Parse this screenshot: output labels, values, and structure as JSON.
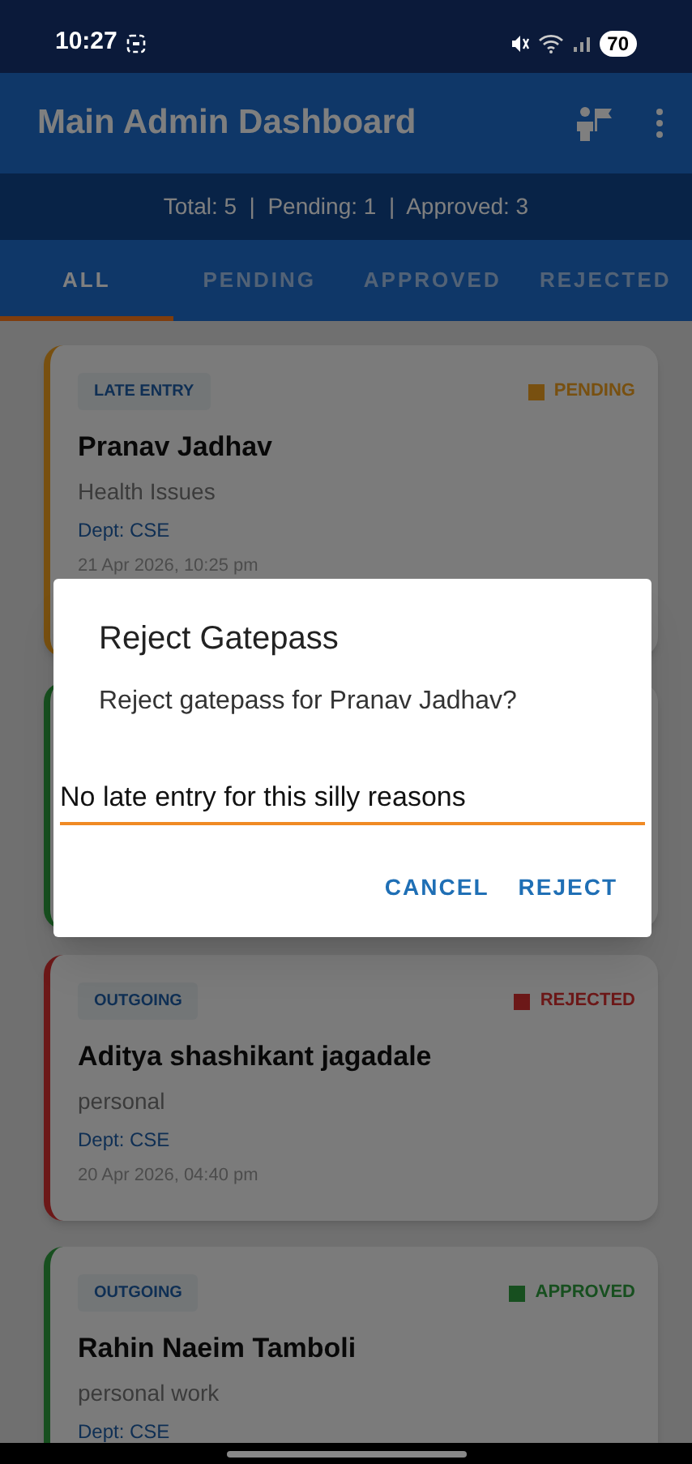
{
  "status_bar": {
    "time": "10:27",
    "battery": "70"
  },
  "app_bar": {
    "title": "Main Admin Dashboard"
  },
  "summary": "Total: 5  |  Pending: 1  |  Approved: 3",
  "tabs": [
    {
      "label": "ALL",
      "selected": true
    },
    {
      "label": "PENDING",
      "selected": false
    },
    {
      "label": "APPROVED",
      "selected": false
    },
    {
      "label": "REJECTED",
      "selected": false
    }
  ],
  "cards": [
    {
      "kind": "pending",
      "type": "LATE ENTRY",
      "status_label": "PENDING",
      "name": "Pranav Jadhav",
      "reason": "Health Issues",
      "dept": "Dept: CSE",
      "date": "21 Apr 2026, 10:25 pm"
    },
    {
      "kind": "approved"
    },
    {
      "kind": "rejected",
      "type": "OUTGOING",
      "status_label": "REJECTED",
      "name": "Aditya shashikant jagadale",
      "reason": "personal",
      "dept": "Dept: CSE",
      "date": "20 Apr 2026, 04:40 pm"
    },
    {
      "kind": "approved",
      "type": "OUTGOING",
      "status_label": "APPROVED",
      "name": "Rahin Naeim Tamboli",
      "reason": "personal work",
      "dept": "Dept: CSE"
    }
  ],
  "dialog": {
    "title": "Reject Gatepass",
    "message": "Reject gatepass for Pranav Jadhav?",
    "input_value": "No late entry for this silly reasons",
    "buttons": [
      "CANCEL",
      "REJECT"
    ]
  }
}
